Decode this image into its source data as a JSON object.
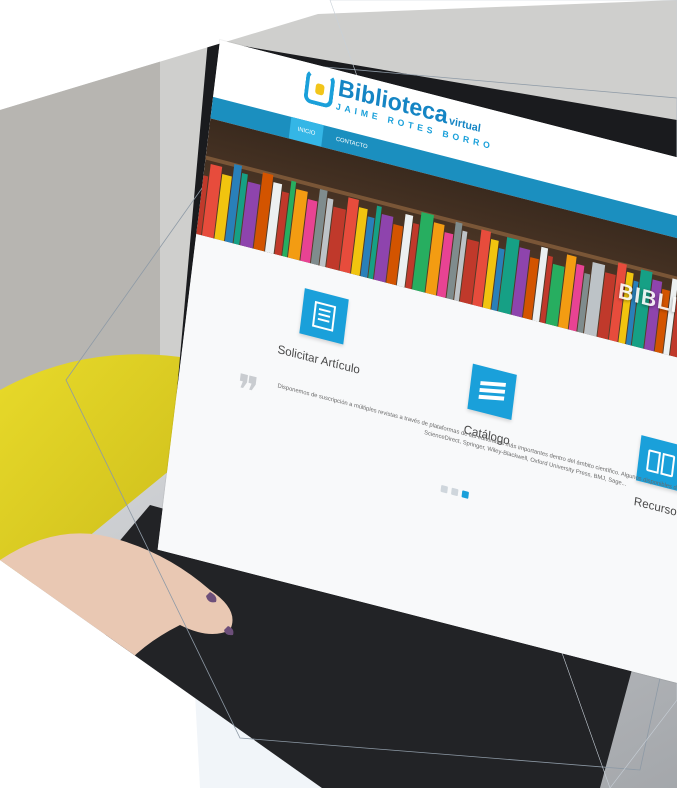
{
  "site": {
    "logo_main": "Biblioteca",
    "logo_suffix": "virtual",
    "logo_sub": "JAIME ROTES BORRO"
  },
  "nav": {
    "items": [
      {
        "label": "INICIO",
        "active": true
      },
      {
        "label": "CONTACTO",
        "active": false
      }
    ]
  },
  "banner": {
    "title": "BIBLIOTECA"
  },
  "features": [
    {
      "label": "Solicitar Artículo",
      "icon": "article-icon"
    },
    {
      "label": "Catálogo",
      "icon": "catalog-icon"
    },
    {
      "label": "Recurso",
      "icon": "book-icon"
    }
  ],
  "description": "Disponemos de suscripción a múltiples revistas a través de plataformas de las editoriales más importantes dentro del ámbito científico. Algunos disponibles desde la Biblioteca Virtual son Elsevier / ScienceDirect, Springer, Wiley-Blackwell, Oxford University Press, BMJ, Sage...",
  "colors": {
    "accent": "#1aa0da",
    "nav": "#1b8fbf",
    "logo": "#1585c4",
    "logo_highlight": "#f2c51a",
    "chair": "#e3d321",
    "laptop_body": "#b9bcc0",
    "keyboard": "#1c1d20"
  }
}
